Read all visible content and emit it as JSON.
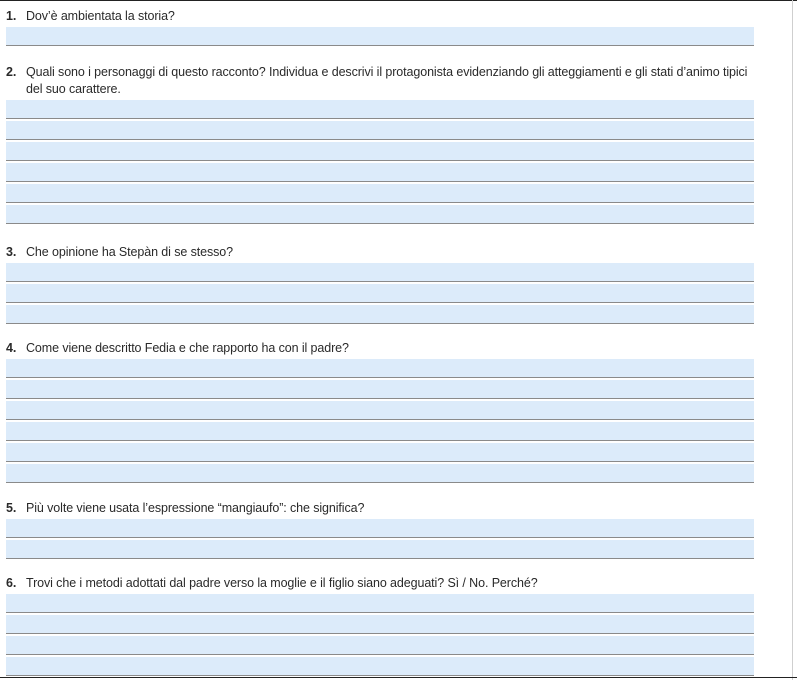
{
  "questions": [
    {
      "num": "1.",
      "text": "Dov’è ambientata la storia?",
      "lines": 1
    },
    {
      "num": "2.",
      "text": "Quali sono i personaggi di questo racconto? Individua e descrivi il protagonista evidenziando gli atteggiamenti e gli stati d’animo tipici del suo carattere.",
      "lines": 6
    },
    {
      "num": "3.",
      "text": "Che opinione ha Stepàn di se stesso?",
      "lines": 3
    },
    {
      "num": "4.",
      "text": "Come viene descritto Fedia e che rapporto ha con il padre?",
      "lines": 6
    },
    {
      "num": "5.",
      "text": "Più volte viene usata l’espressione “mangiaufo”: che significa?",
      "lines": 2
    },
    {
      "num": "6.",
      "text": "Trovi che i metodi adottati dal padre verso la moglie e il figlio siano adeguati? Sì / No. Perché?",
      "lines": 4
    }
  ]
}
